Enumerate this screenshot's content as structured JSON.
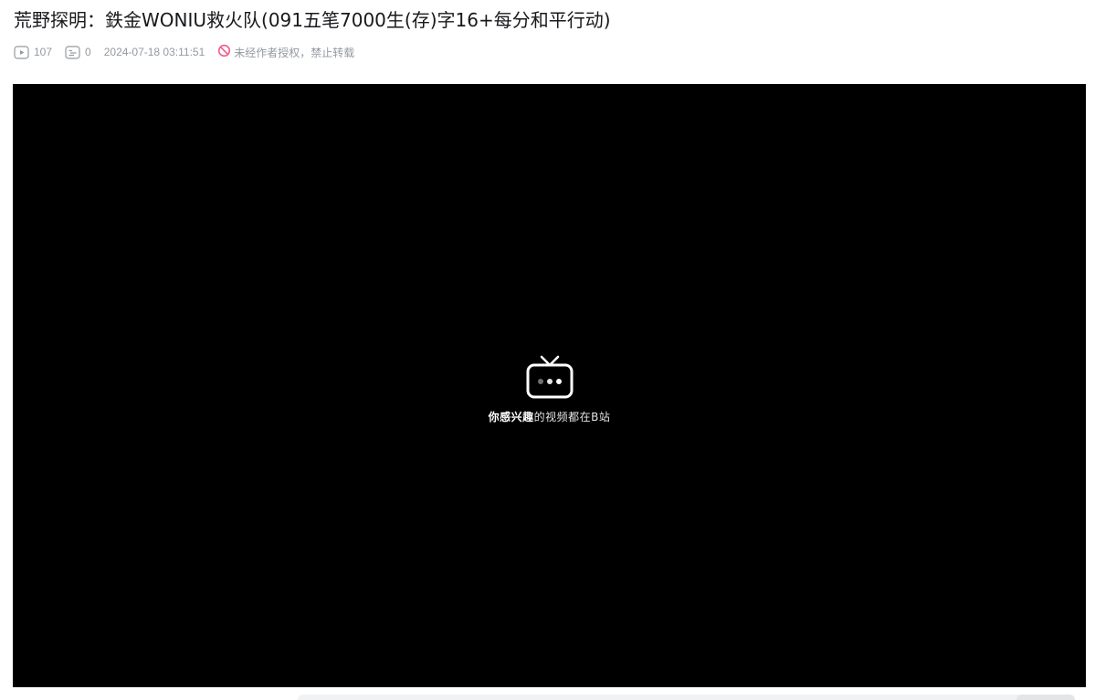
{
  "video": {
    "title": "荒野探明：鉄金WONIU救火队(091五笔7000生(存)字16+每分和平行动)",
    "play_count": "107",
    "danmaku_count": "0",
    "publish_time": "2024-07-18 03:11:51",
    "copyright_notice": "未经作者授权，禁止转载"
  },
  "player": {
    "slogan_strong": "你感兴趣",
    "slogan_rest": "的视频都在B站"
  },
  "icons": {
    "play_count": "play-icon",
    "danmaku_count": "danmaku-icon",
    "copyright": "no-entry-icon",
    "player_logo": "bilibili-tv-icon"
  },
  "colors": {
    "title": "#18191c",
    "meta": "#9499a0",
    "prohibit": "#f25d8e",
    "player_bg": "#000000"
  }
}
